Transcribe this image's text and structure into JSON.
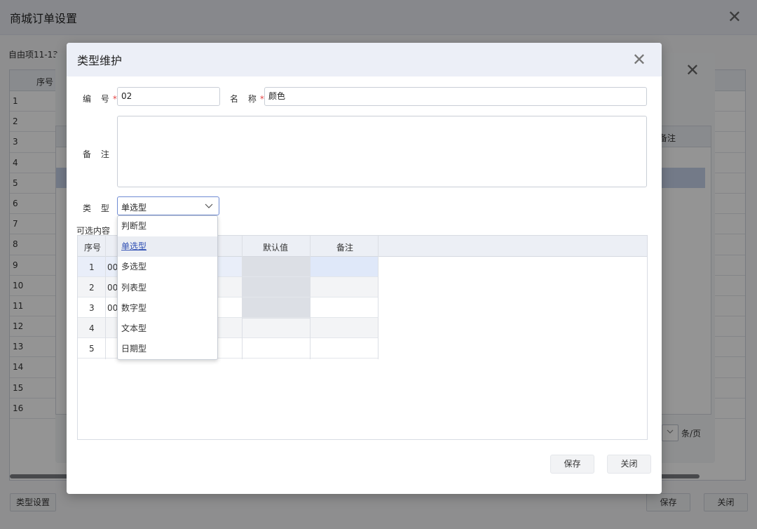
{
  "base": {
    "title": "商城订单设置",
    "subtitle": "自由项11-13",
    "table_header": "序号",
    "rows": [
      "1",
      "2",
      "3",
      "4",
      "5",
      "6",
      "7",
      "8",
      "9",
      "10",
      "11",
      "12",
      "13",
      "14",
      "15",
      "16"
    ],
    "type_settings_btn": "类型设置",
    "save_btn": "保存",
    "close_btn": "关闭"
  },
  "middle": {
    "header_col": "备注",
    "per_page": "条/页"
  },
  "dialog": {
    "title": "类型维护",
    "code_label": "编 号",
    "code_value": "02",
    "name_label": "名 称",
    "name_value": "颜色",
    "remark_label": "备 注",
    "remark_value": "",
    "type_label": "类 型",
    "type_value": "单选型",
    "options_label": "可选内容",
    "grid_headers": {
      "seq": "序号",
      "default": "默认值",
      "remark": "备注"
    },
    "grid_rows": [
      {
        "seq": "1",
        "code": "00"
      },
      {
        "seq": "2",
        "code": "00"
      },
      {
        "seq": "3",
        "code": "00"
      },
      {
        "seq": "4",
        "code": ""
      },
      {
        "seq": "5",
        "code": ""
      }
    ],
    "save_btn": "保存",
    "close_btn": "关闭",
    "dropdown_options": [
      "判断型",
      "单选型",
      "多选型",
      "列表型",
      "数字型",
      "文本型",
      "日期型"
    ],
    "dropdown_selected": "单选型",
    "required_mark": "*"
  }
}
